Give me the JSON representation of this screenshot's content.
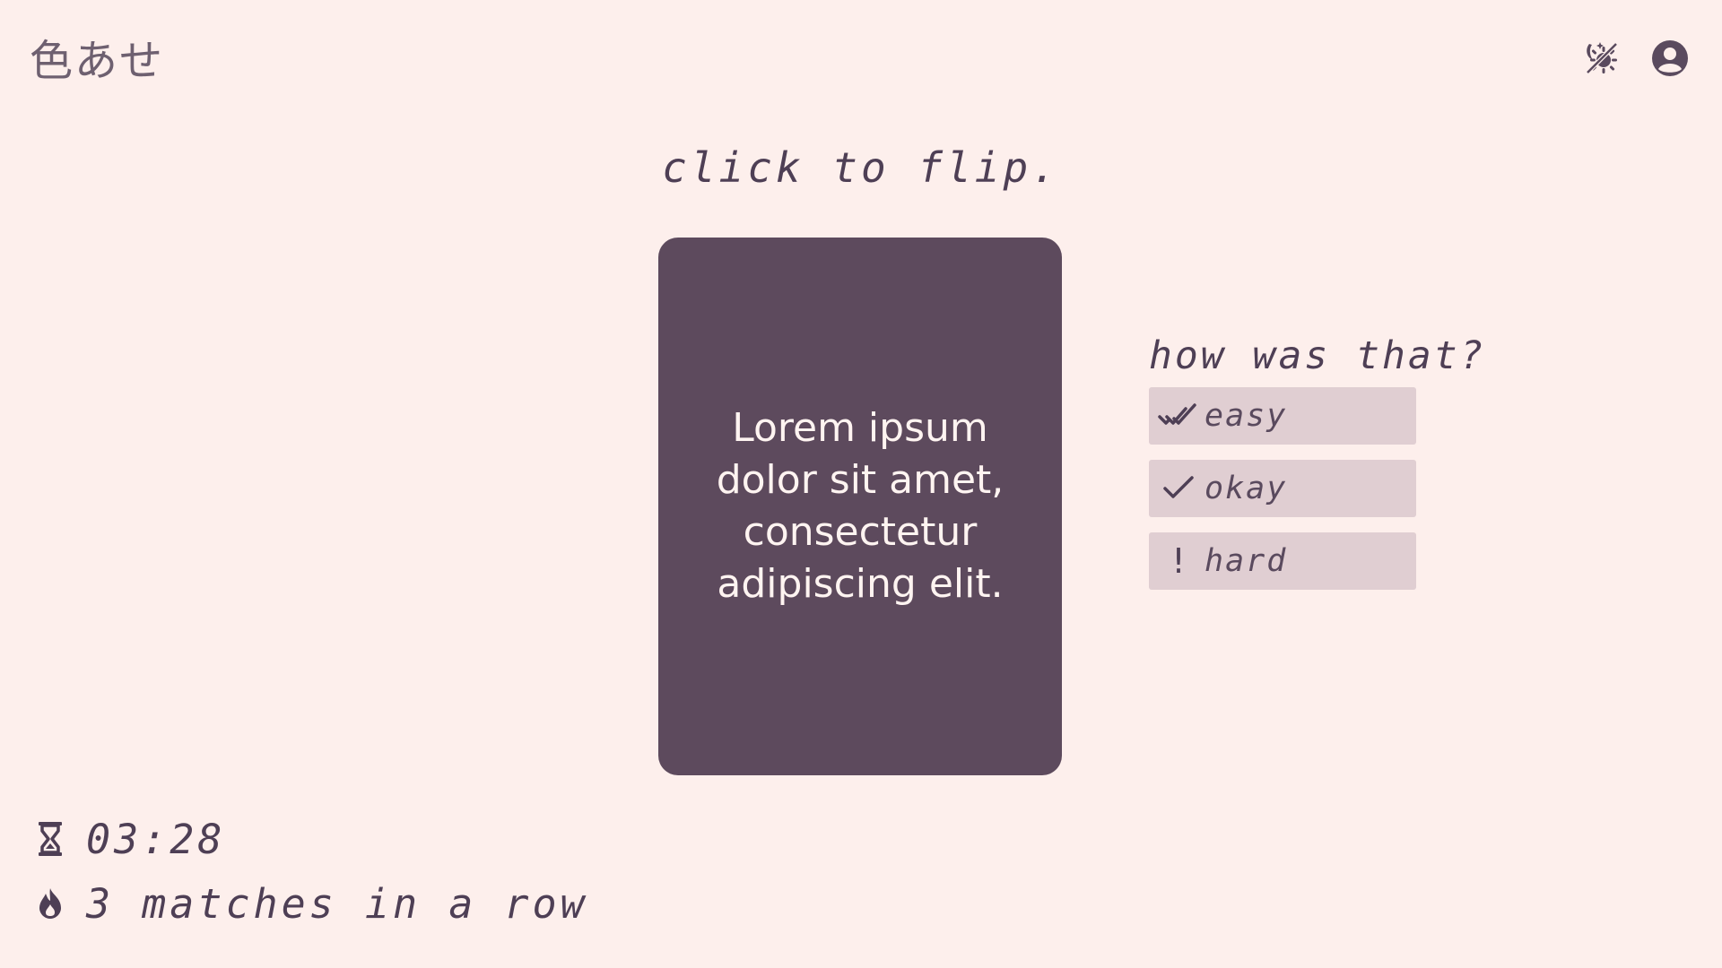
{
  "header": {
    "logo": "色あせ",
    "icons": [
      "theme-toggle-icon",
      "account-icon"
    ]
  },
  "prompt": "click to flip.",
  "card": {
    "text": "Lorem ipsum dolor sit amet, consectetur adipiscing elit."
  },
  "rating": {
    "title": "how was that?",
    "options": [
      {
        "label": "easy",
        "icon": "double-check-icon"
      },
      {
        "label": "okay",
        "icon": "check-icon"
      },
      {
        "label": "hard",
        "icon": "exclamation-icon",
        "glyph": "!"
      }
    ]
  },
  "stats": {
    "timer": "03:28",
    "streak": "3 matches in a row"
  },
  "colors": {
    "background": "#fdefec",
    "card": "#5d4a5d",
    "button": "#e0ced2",
    "text": "#4e3f55"
  }
}
